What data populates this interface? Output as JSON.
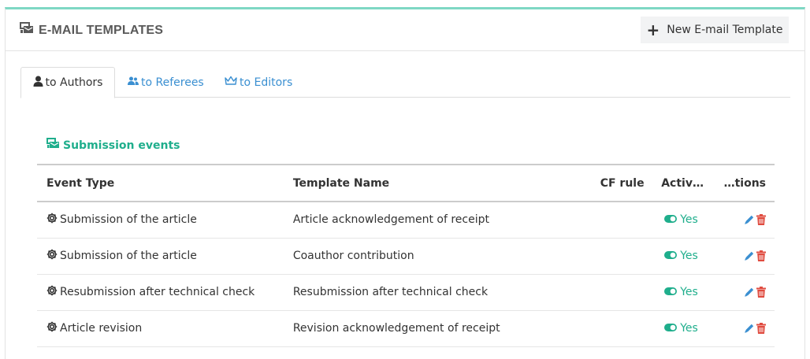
{
  "header": {
    "title": "E-MAIL TEMPLATES",
    "new_button_label": "New E-mail Template"
  },
  "tabs": [
    {
      "label": "to Authors",
      "icon": "user-icon",
      "active": true
    },
    {
      "label": "to Referees",
      "icon": "users-icon",
      "active": false
    },
    {
      "label": "to Editors",
      "icon": "crown-icon",
      "active": false
    }
  ],
  "section": {
    "title": "Submission events"
  },
  "table": {
    "columns": [
      "Event Type",
      "Template Name",
      "CF rule",
      "Activ…",
      "…tions"
    ],
    "rows": [
      {
        "event_type": "Submission of the article",
        "template_name": "Article acknowledgement of receipt",
        "cf_rule": "",
        "active": "Yes"
      },
      {
        "event_type": "Submission of the article",
        "template_name": "Coauthor contribution",
        "cf_rule": "",
        "active": "Yes"
      },
      {
        "event_type": "Resubmission after technical check",
        "template_name": "Resubmission after technical check",
        "cf_rule": "",
        "active": "Yes"
      },
      {
        "event_type": "Article revision",
        "template_name": "Revision acknowledgement of receipt",
        "cf_rule": "",
        "active": "Yes"
      }
    ]
  },
  "colors": {
    "accent_teal": "#1fae8c",
    "top_border": "#7fd8c4",
    "link_blue": "#3a8fd1",
    "edit_blue": "#3a8fd1",
    "delete_red": "#e04b3f",
    "title_gray": "#595959"
  }
}
